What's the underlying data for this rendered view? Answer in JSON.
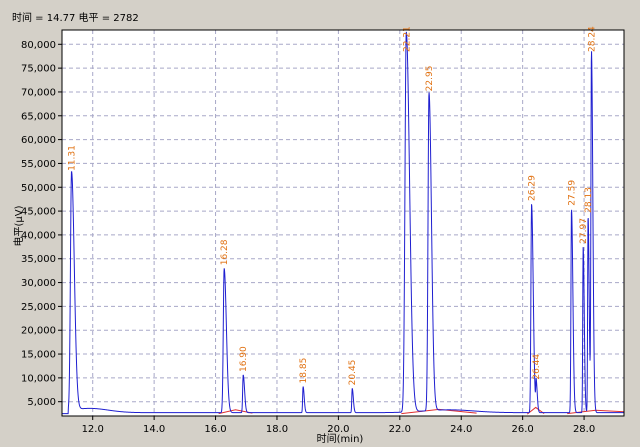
{
  "readout": {
    "text": "时间 = 14.77  电平 = 2782"
  },
  "colors": {
    "background": "#d4d0c8",
    "plot_bg": "#ffffff",
    "signal": "#1f1fd0",
    "baseline": "#e03030",
    "peak_label": "#e07010",
    "grid": "#a8a8c8"
  },
  "chart_data": {
    "type": "line",
    "xlabel": "时间(min)",
    "ylabel": "电平(µV)",
    "xlim": [
      11.0,
      29.3
    ],
    "ylim": [
      2000,
      83000
    ],
    "grid": true,
    "x_ticks": [
      12.0,
      14.0,
      16.0,
      18.0,
      20.0,
      22.0,
      24.0,
      26.0,
      28.0
    ],
    "x_tick_labels": [
      "12.0",
      "14.0",
      "16.0",
      "18.0",
      "20.0",
      "22.0",
      "24.0",
      "26.0",
      "28.0"
    ],
    "y_ticks": [
      5000,
      10000,
      15000,
      20000,
      25000,
      30000,
      35000,
      40000,
      45000,
      50000,
      55000,
      60000,
      65000,
      70000,
      75000,
      80000
    ],
    "y_tick_labels": [
      "5,000",
      "10,000",
      "15,000",
      "20,000",
      "25,000",
      "30,000",
      "35,000",
      "40,000",
      "45,000",
      "50,000",
      "55,000",
      "60,000",
      "65,000",
      "70,000",
      "75,000",
      "80,000"
    ],
    "baseline_level": 2700,
    "peaks": [
      {
        "label": "11.31",
        "x": 11.31,
        "height": 52800,
        "width": 0.1
      },
      {
        "label": "16.28",
        "x": 16.28,
        "height": 33000,
        "width": 0.08
      },
      {
        "label": "16.90",
        "x": 16.9,
        "height": 10600,
        "width": 0.05
      },
      {
        "label": "18.85",
        "x": 18.85,
        "height": 8200,
        "width": 0.04
      },
      {
        "label": "20.45",
        "x": 20.45,
        "height": 7800,
        "width": 0.04
      },
      {
        "label": "22.21",
        "x": 22.21,
        "height": 82500,
        "width": 0.12
      },
      {
        "label": "22.95",
        "x": 22.95,
        "height": 69500,
        "width": 0.09
      },
      {
        "label": "26.29",
        "x": 26.29,
        "height": 46500,
        "width": 0.06
      },
      {
        "label": "26.44",
        "x": 26.44,
        "height": 9000,
        "width": 0.04
      },
      {
        "label": "27.59",
        "x": 27.59,
        "height": 45500,
        "width": 0.05
      },
      {
        "label": "27.97",
        "x": 27.97,
        "height": 37500,
        "width": 0.04
      },
      {
        "label": "28.13",
        "x": 28.13,
        "height": 44000,
        "width": 0.04
      },
      {
        "label": "28.24",
        "x": 28.24,
        "height": 78500,
        "width": 0.05
      }
    ]
  }
}
